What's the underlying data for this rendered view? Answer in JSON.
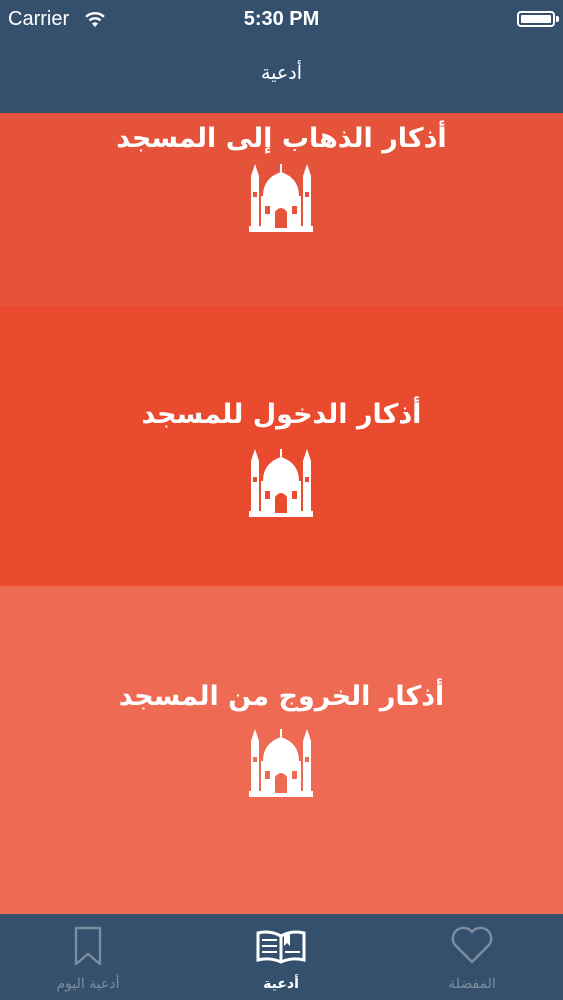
{
  "status_bar": {
    "carrier": "Carrier",
    "time": "5:30 PM"
  },
  "nav": {
    "title": "أدعية"
  },
  "cards": [
    {
      "title": "أذكار الذهاب إلى المسجد",
      "icon": "mosque-icon",
      "color": "#e5533b"
    },
    {
      "title": "أذكار الدخول للمسجد",
      "icon": "mosque-icon",
      "color": "#ea4a2e"
    },
    {
      "title": "أذكار الخروج من المسجد",
      "icon": "mosque-icon",
      "color": "#ee6a53"
    }
  ],
  "tabs": [
    {
      "label": "المفضلة",
      "icon": "heart-icon",
      "active": false
    },
    {
      "label": "أدعية",
      "icon": "open-book-icon",
      "active": true
    },
    {
      "label": "أدعية اليوم",
      "icon": "bookmark-icon",
      "active": false
    }
  ],
  "colors": {
    "nav_bg": "#34506d",
    "tab_inactive": "#7c8d9f",
    "tab_active": "#ffffff"
  }
}
